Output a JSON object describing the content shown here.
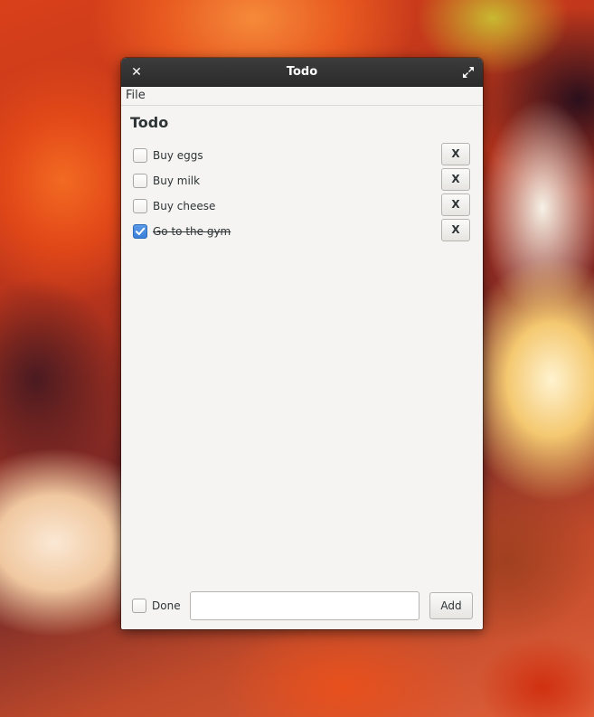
{
  "window": {
    "title": "Todo",
    "close_icon": "close-icon",
    "maximize_icon": "maximize-icon"
  },
  "menubar": {
    "items": [
      {
        "label": "File"
      }
    ]
  },
  "main": {
    "heading": "Todo",
    "todos": [
      {
        "label": "Buy eggs",
        "done": false,
        "delete_label": "X"
      },
      {
        "label": "Buy milk",
        "done": false,
        "delete_label": "X"
      },
      {
        "label": "Buy cheese",
        "done": false,
        "delete_label": "X"
      },
      {
        "label": "Go to the gym",
        "done": true,
        "delete_label": "X"
      }
    ]
  },
  "footer": {
    "done_label": "Done",
    "done_checked": false,
    "new_todo_value": "",
    "add_label": "Add"
  },
  "colors": {
    "checkbox_checked": "#3b7fd8",
    "titlebar": "#2b2b2b",
    "window_bg": "#f5f4f2"
  }
}
